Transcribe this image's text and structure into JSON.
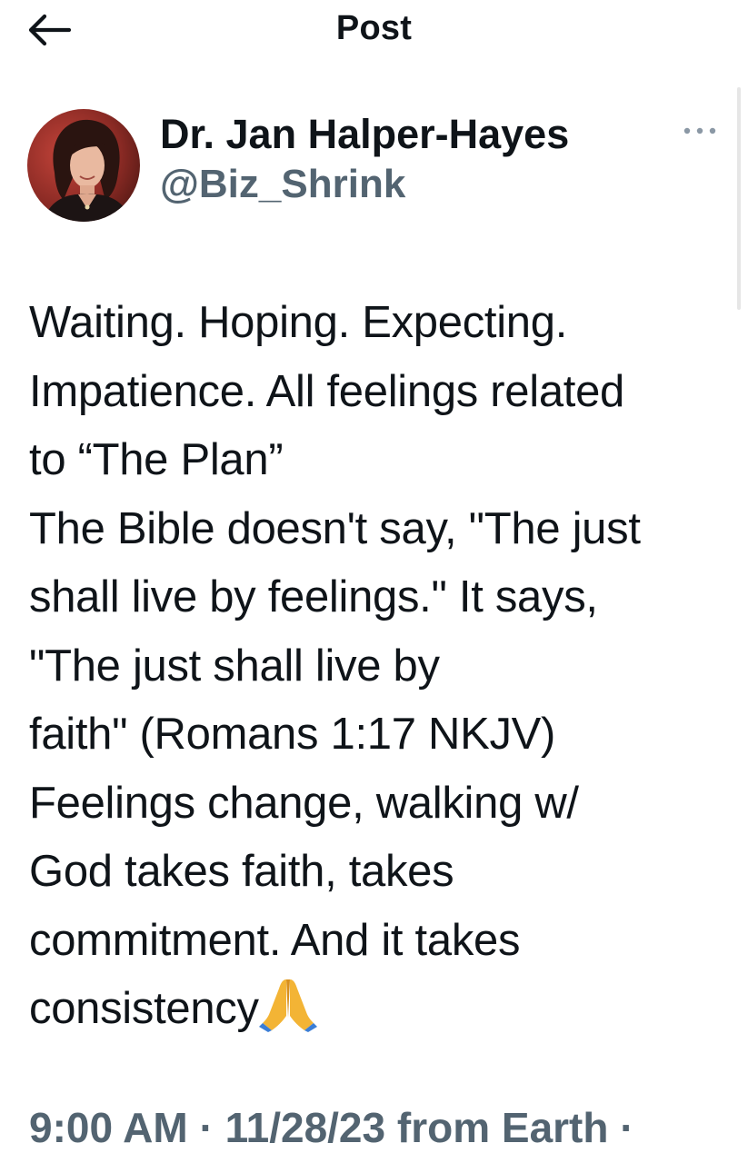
{
  "header": {
    "back_icon": "arrow-left-icon",
    "title": "Post"
  },
  "author": {
    "avatar_icon": "profile-photo",
    "display_name": "Dr. Jan Halper-Hayes",
    "handle": "@Biz_Shrink",
    "more_icon": "more-horizontal-icon"
  },
  "tweet": {
    "text": "Waiting. Hoping. Expecting.\nImpatience. All feelings related\nto “The Plan”\nThe Bible doesn't say, \"The just\nshall live by feelings.\" It says,\n\"The just shall live by\nfaith\" (Romans 1:17 NKJV)\nFeelings change, walking w/\nGod takes faith, takes\ncommitment. And it takes\nconsistency",
    "emoji": "folded-hands-icon"
  },
  "meta": {
    "time": "9:00 AM",
    "separator": "·",
    "date": "11/28/23",
    "source": "from Earth",
    "trailing_separator": "·"
  },
  "colors": {
    "text": "#0f1419",
    "secondary": "#536471",
    "background": "#ffffff"
  }
}
